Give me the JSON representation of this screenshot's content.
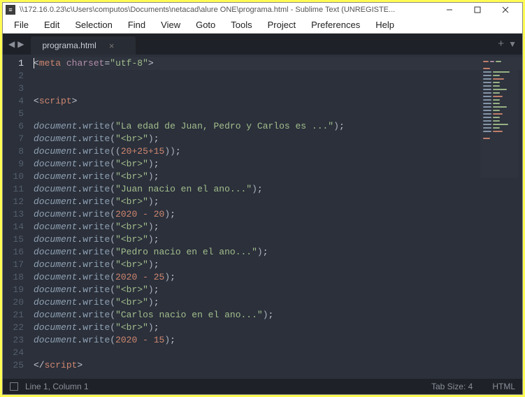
{
  "titlebar": {
    "path": "\\\\172.16.0.23\\c\\Users\\computos\\Documents\\netacad\\alure ONE\\programa.html - Sublime Text (UNREGISTE..."
  },
  "menubar": {
    "file": "File",
    "edit": "Edit",
    "selection": "Selection",
    "find": "Find",
    "view": "View",
    "goto": "Goto",
    "tools": "Tools",
    "project": "Project",
    "preferences": "Preferences",
    "help": "Help"
  },
  "tabs": {
    "active": "programa.html"
  },
  "code": {
    "lines": [
      {
        "n": 1,
        "tokens": [
          {
            "t": "punct",
            "v": "<"
          },
          {
            "t": "tag",
            "v": "meta"
          },
          {
            "t": "plain",
            "v": " "
          },
          {
            "t": "attr",
            "v": "charset"
          },
          {
            "t": "op",
            "v": "="
          },
          {
            "t": "str",
            "v": "\"utf-8\""
          },
          {
            "t": "punct",
            "v": ">"
          }
        ]
      },
      {
        "n": 2,
        "tokens": []
      },
      {
        "n": 3,
        "tokens": []
      },
      {
        "n": 4,
        "tokens": [
          {
            "t": "punct",
            "v": "<"
          },
          {
            "t": "tag",
            "v": "script"
          },
          {
            "t": "punct",
            "v": ">"
          }
        ]
      },
      {
        "n": 5,
        "tokens": []
      },
      {
        "n": 6,
        "tokens": [
          {
            "t": "obj",
            "v": "document"
          },
          {
            "t": "punct",
            "v": "."
          },
          {
            "t": "fn",
            "v": "write"
          },
          {
            "t": "bracket",
            "v": "("
          },
          {
            "t": "str",
            "v": "\"La edad de Juan, Pedro y Carlos es ...\""
          },
          {
            "t": "bracket",
            "v": ")"
          },
          {
            "t": "punct",
            "v": ";"
          }
        ]
      },
      {
        "n": 7,
        "tokens": [
          {
            "t": "obj",
            "v": "document"
          },
          {
            "t": "punct",
            "v": "."
          },
          {
            "t": "fn",
            "v": "write"
          },
          {
            "t": "bracket",
            "v": "("
          },
          {
            "t": "str",
            "v": "\"<br>\""
          },
          {
            "t": "bracket",
            "v": ")"
          },
          {
            "t": "punct",
            "v": ";"
          }
        ]
      },
      {
        "n": 8,
        "tokens": [
          {
            "t": "obj",
            "v": "document"
          },
          {
            "t": "punct",
            "v": "."
          },
          {
            "t": "fn",
            "v": "write"
          },
          {
            "t": "bracket",
            "v": "(("
          },
          {
            "t": "num",
            "v": "20"
          },
          {
            "t": "kwop",
            "v": "+"
          },
          {
            "t": "num",
            "v": "25"
          },
          {
            "t": "kwop",
            "v": "+"
          },
          {
            "t": "num",
            "v": "15"
          },
          {
            "t": "bracket",
            "v": "))"
          },
          {
            "t": "punct",
            "v": ";"
          }
        ]
      },
      {
        "n": 9,
        "tokens": [
          {
            "t": "obj",
            "v": "document"
          },
          {
            "t": "punct",
            "v": "."
          },
          {
            "t": "fn",
            "v": "write"
          },
          {
            "t": "bracket",
            "v": "("
          },
          {
            "t": "str",
            "v": "\"<br>\""
          },
          {
            "t": "bracket",
            "v": ")"
          },
          {
            "t": "punct",
            "v": ";"
          }
        ]
      },
      {
        "n": 10,
        "tokens": [
          {
            "t": "obj",
            "v": "document"
          },
          {
            "t": "punct",
            "v": "."
          },
          {
            "t": "fn",
            "v": "write"
          },
          {
            "t": "bracket",
            "v": "("
          },
          {
            "t": "str",
            "v": "\"<br>\""
          },
          {
            "t": "bracket",
            "v": ")"
          },
          {
            "t": "punct",
            "v": ";"
          }
        ]
      },
      {
        "n": 11,
        "tokens": [
          {
            "t": "obj",
            "v": "document"
          },
          {
            "t": "punct",
            "v": "."
          },
          {
            "t": "fn",
            "v": "write"
          },
          {
            "t": "bracket",
            "v": "("
          },
          {
            "t": "str",
            "v": "\"Juan nacio en el ano...\""
          },
          {
            "t": "bracket",
            "v": ")"
          },
          {
            "t": "punct",
            "v": ";"
          }
        ]
      },
      {
        "n": 12,
        "tokens": [
          {
            "t": "obj",
            "v": "document"
          },
          {
            "t": "punct",
            "v": "."
          },
          {
            "t": "fn",
            "v": "write"
          },
          {
            "t": "bracket",
            "v": "("
          },
          {
            "t": "str",
            "v": "\"<br>\""
          },
          {
            "t": "bracket",
            "v": ")"
          },
          {
            "t": "punct",
            "v": ";"
          }
        ]
      },
      {
        "n": 13,
        "tokens": [
          {
            "t": "obj",
            "v": "document"
          },
          {
            "t": "punct",
            "v": "."
          },
          {
            "t": "fn",
            "v": "write"
          },
          {
            "t": "bracket",
            "v": "("
          },
          {
            "t": "num",
            "v": "2020"
          },
          {
            "t": "plain",
            "v": " "
          },
          {
            "t": "kwop",
            "v": "-"
          },
          {
            "t": "plain",
            "v": " "
          },
          {
            "t": "num",
            "v": "20"
          },
          {
            "t": "bracket",
            "v": ")"
          },
          {
            "t": "punct",
            "v": ";"
          }
        ]
      },
      {
        "n": 14,
        "tokens": [
          {
            "t": "obj",
            "v": "document"
          },
          {
            "t": "punct",
            "v": "."
          },
          {
            "t": "fn",
            "v": "write"
          },
          {
            "t": "bracket",
            "v": "("
          },
          {
            "t": "str",
            "v": "\"<br>\""
          },
          {
            "t": "bracket",
            "v": ")"
          },
          {
            "t": "punct",
            "v": ";"
          }
        ]
      },
      {
        "n": 15,
        "tokens": [
          {
            "t": "obj",
            "v": "document"
          },
          {
            "t": "punct",
            "v": "."
          },
          {
            "t": "fn",
            "v": "write"
          },
          {
            "t": "bracket",
            "v": "("
          },
          {
            "t": "str",
            "v": "\"<br>\""
          },
          {
            "t": "bracket",
            "v": ")"
          },
          {
            "t": "punct",
            "v": ";"
          }
        ]
      },
      {
        "n": 16,
        "tokens": [
          {
            "t": "obj",
            "v": "document"
          },
          {
            "t": "punct",
            "v": "."
          },
          {
            "t": "fn",
            "v": "write"
          },
          {
            "t": "bracket",
            "v": "("
          },
          {
            "t": "str",
            "v": "\"Pedro nacio en el ano...\""
          },
          {
            "t": "bracket",
            "v": ")"
          },
          {
            "t": "punct",
            "v": ";"
          }
        ]
      },
      {
        "n": 17,
        "tokens": [
          {
            "t": "obj",
            "v": "document"
          },
          {
            "t": "punct",
            "v": "."
          },
          {
            "t": "fn",
            "v": "write"
          },
          {
            "t": "bracket",
            "v": "("
          },
          {
            "t": "str",
            "v": "\"<br>\""
          },
          {
            "t": "bracket",
            "v": ")"
          },
          {
            "t": "punct",
            "v": ";"
          }
        ]
      },
      {
        "n": 18,
        "tokens": [
          {
            "t": "obj",
            "v": "document"
          },
          {
            "t": "punct",
            "v": "."
          },
          {
            "t": "fn",
            "v": "write"
          },
          {
            "t": "bracket",
            "v": "("
          },
          {
            "t": "num",
            "v": "2020"
          },
          {
            "t": "plain",
            "v": " "
          },
          {
            "t": "kwop",
            "v": "-"
          },
          {
            "t": "plain",
            "v": " "
          },
          {
            "t": "num",
            "v": "25"
          },
          {
            "t": "bracket",
            "v": ")"
          },
          {
            "t": "punct",
            "v": ";"
          }
        ]
      },
      {
        "n": 19,
        "tokens": [
          {
            "t": "obj",
            "v": "document"
          },
          {
            "t": "punct",
            "v": "."
          },
          {
            "t": "fn",
            "v": "write"
          },
          {
            "t": "bracket",
            "v": "("
          },
          {
            "t": "str",
            "v": "\"<br>\""
          },
          {
            "t": "bracket",
            "v": ")"
          },
          {
            "t": "punct",
            "v": ";"
          }
        ]
      },
      {
        "n": 20,
        "tokens": [
          {
            "t": "obj",
            "v": "document"
          },
          {
            "t": "punct",
            "v": "."
          },
          {
            "t": "fn",
            "v": "write"
          },
          {
            "t": "bracket",
            "v": "("
          },
          {
            "t": "str",
            "v": "\"<br>\""
          },
          {
            "t": "bracket",
            "v": ")"
          },
          {
            "t": "punct",
            "v": ";"
          }
        ]
      },
      {
        "n": 21,
        "tokens": [
          {
            "t": "obj",
            "v": "document"
          },
          {
            "t": "punct",
            "v": "."
          },
          {
            "t": "fn",
            "v": "write"
          },
          {
            "t": "bracket",
            "v": "("
          },
          {
            "t": "str",
            "v": "\"Carlos nacio en el ano...\""
          },
          {
            "t": "bracket",
            "v": ")"
          },
          {
            "t": "punct",
            "v": ";"
          }
        ]
      },
      {
        "n": 22,
        "tokens": [
          {
            "t": "obj",
            "v": "document"
          },
          {
            "t": "punct",
            "v": "."
          },
          {
            "t": "fn",
            "v": "write"
          },
          {
            "t": "bracket",
            "v": "("
          },
          {
            "t": "str",
            "v": "\"<br>\""
          },
          {
            "t": "bracket",
            "v": ")"
          },
          {
            "t": "punct",
            "v": ";"
          }
        ]
      },
      {
        "n": 23,
        "tokens": [
          {
            "t": "obj",
            "v": "document"
          },
          {
            "t": "punct",
            "v": "."
          },
          {
            "t": "fn",
            "v": "write"
          },
          {
            "t": "bracket",
            "v": "("
          },
          {
            "t": "num",
            "v": "2020"
          },
          {
            "t": "plain",
            "v": " "
          },
          {
            "t": "kwop",
            "v": "-"
          },
          {
            "t": "plain",
            "v": " "
          },
          {
            "t": "num",
            "v": "15"
          },
          {
            "t": "bracket",
            "v": ")"
          },
          {
            "t": "punct",
            "v": ";"
          }
        ]
      },
      {
        "n": 24,
        "tokens": []
      },
      {
        "n": 25,
        "tokens": [
          {
            "t": "punct",
            "v": "</"
          },
          {
            "t": "tag",
            "v": "script"
          },
          {
            "t": "punct",
            "v": ">"
          }
        ]
      }
    ],
    "active_line": 1
  },
  "statusbar": {
    "position": "Line 1, Column 1",
    "tabsize": "Tab Size: 4",
    "syntax": "HTML"
  }
}
